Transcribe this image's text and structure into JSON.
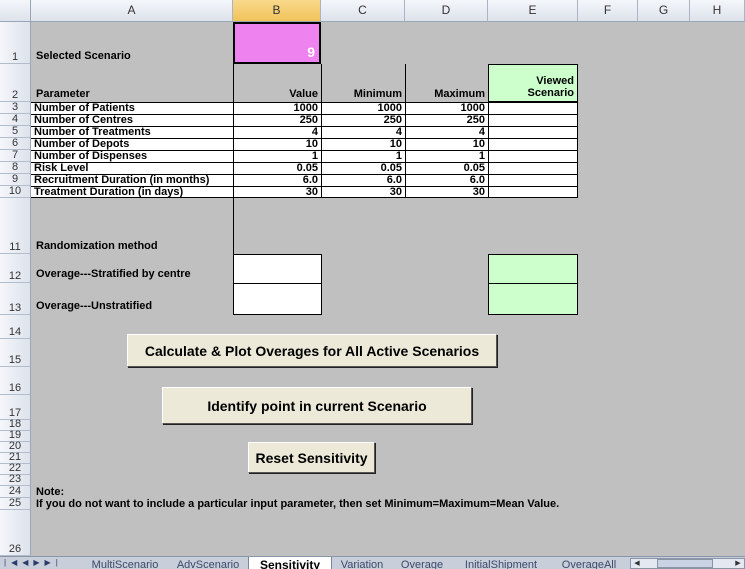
{
  "columns": [
    "A",
    "B",
    "C",
    "D",
    "E",
    "F",
    "G",
    "H"
  ],
  "rows": [
    "1",
    "2",
    "3",
    "4",
    "5",
    "6",
    "7",
    "8",
    "9",
    "10",
    "11",
    "12",
    "13",
    "14",
    "15",
    "16",
    "17",
    "18",
    "19",
    "20",
    "21",
    "22",
    "23",
    "24",
    "25",
    "26"
  ],
  "row1": {
    "label": "Selected Scenario",
    "value": "9"
  },
  "headers": {
    "parameter": "Parameter",
    "value": "Value",
    "minimum": "Minimum",
    "maximum": "Maximum",
    "viewed_line1": "Viewed",
    "viewed_line2": "Scenario"
  },
  "params": [
    {
      "name": "Number of Patients",
      "value": "1000",
      "min": "1000",
      "max": "1000"
    },
    {
      "name": "Number of Centres",
      "value": "250",
      "min": "250",
      "max": "250"
    },
    {
      "name": "Number of Treatments",
      "value": "4",
      "min": "4",
      "max": "4"
    },
    {
      "name": "Number of Depots",
      "value": "10",
      "min": "10",
      "max": "10"
    },
    {
      "name": "Number of Dispenses",
      "value": "1",
      "min": "1",
      "max": "1"
    },
    {
      "name": "Risk Level",
      "value": "0.05",
      "min": "0.05",
      "max": "0.05"
    },
    {
      "name": "Recruitment Duration (in months)",
      "value": "6.0",
      "min": "6.0",
      "max": "6.0"
    },
    {
      "name": "Treatment Duration (in days)",
      "value": "30",
      "min": "30",
      "max": "30"
    }
  ],
  "randomization_label": "Randomization method",
  "overage_stratified": "Overage---Stratified by centre",
  "overage_unstratified": "Overage---Unstratified",
  "buttons": {
    "calculate": "Calculate & Plot Overages for All Active Scenarios",
    "identify": "Identify point in current Scenario",
    "reset": "Reset Sensitivity"
  },
  "note_title": "Note:",
  "note_text": "If you do not want to include a particular input parameter, then set Minimum=Maximum=Mean Value.",
  "tabs": [
    "MultiScenario",
    "AdvScenario",
    "Sensitivity",
    "Variation",
    "Overage",
    "InitialShipment",
    "OverageAll"
  ],
  "active_tab": "Sensitivity",
  "colors": {
    "selected_value": "#ee82ee",
    "viewed": "#ccffcc",
    "sheet_bg": "#c0c0c0"
  }
}
